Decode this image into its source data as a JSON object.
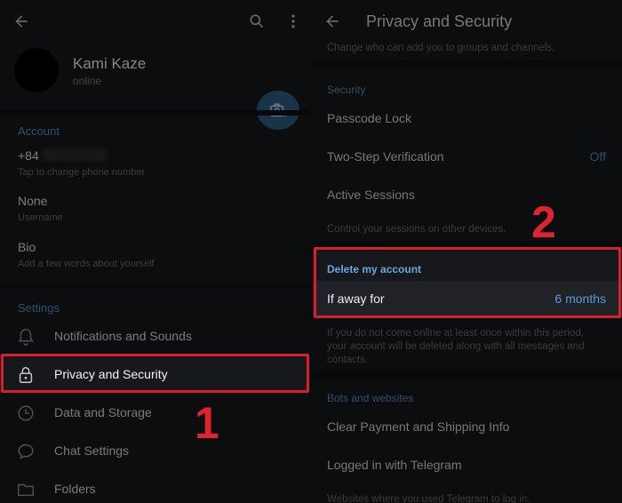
{
  "left": {
    "profile": {
      "name": "Kami Kaze",
      "status": "online"
    },
    "account": {
      "section_title": "Account",
      "phone": "+84",
      "phone_sub": "Tap to change phone number",
      "username": "None",
      "username_sub": "Username",
      "bio": "Bio",
      "bio_sub": "Add a few words about yourself"
    },
    "settings": {
      "section_title": "Settings",
      "items": [
        {
          "label": "Notifications and Sounds",
          "icon": "bell-icon"
        },
        {
          "label": "Privacy and Security",
          "icon": "lock-icon"
        },
        {
          "label": "Data and Storage",
          "icon": "clock-icon"
        },
        {
          "label": "Chat Settings",
          "icon": "chat-bubble-icon"
        },
        {
          "label": "Folders",
          "icon": "folder-icon"
        }
      ]
    },
    "annotation": "1"
  },
  "right": {
    "title": "Privacy and Security",
    "top_sub": "Change who can add you to groups and channels.",
    "security": {
      "section_title": "Security",
      "passcode": "Passcode Lock",
      "two_step": "Two-Step Verification",
      "two_step_value": "Off",
      "active_sessions": "Active Sessions",
      "sessions_sub": "Control your sessions on other devices."
    },
    "delete_account": {
      "section_title": "Delete my account",
      "if_away": "If away for",
      "if_away_value": "6 months",
      "note": "If you do not come online at least once within this period, your account will be deleted along with all messages and contacts."
    },
    "bots": {
      "section_title": "Bots and websites",
      "clear_payment": "Clear Payment and Shipping Info",
      "logged_in": "Logged in with Telegram",
      "logged_sub": "Websites where you used Telegram to log in."
    },
    "annotation": "2"
  },
  "colors": {
    "accent": "#5a8fbc",
    "value_blue": "#4f8dc7",
    "highlight_red": "#d6202a",
    "background": "#17181c"
  }
}
